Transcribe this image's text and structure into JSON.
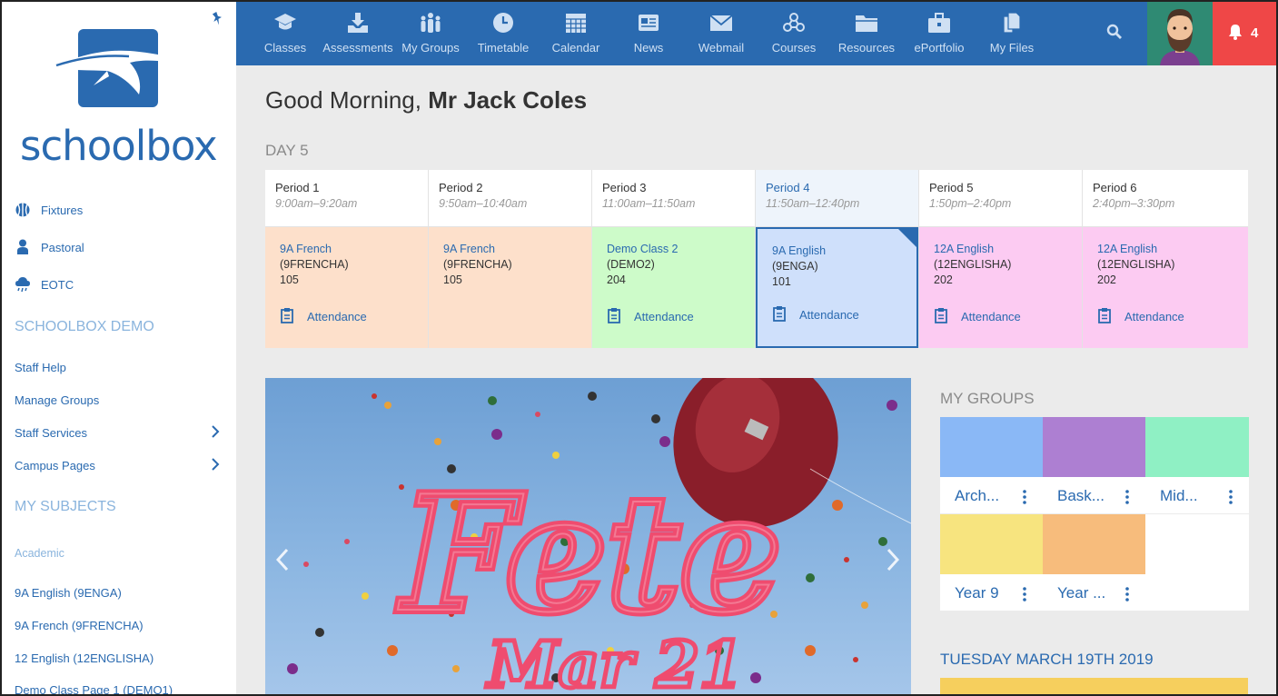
{
  "brand": {
    "name": "schoolbox",
    "color": "#2a6ab0"
  },
  "sidebar": {
    "quick_links": [
      {
        "label": "Fixtures",
        "icon": "basketball-icon"
      },
      {
        "label": "Pastoral",
        "icon": "person-icon"
      },
      {
        "label": "EOTC",
        "icon": "weather-icon"
      }
    ],
    "section1_title": "SCHOOLBOX DEMO",
    "section1_links": [
      "Staff Help",
      "Manage Groups",
      "Staff Services",
      "Campus Pages"
    ],
    "section2_title": "MY SUBJECTS",
    "section2_sub": "Academic",
    "subjects": [
      "9A English (9ENGA)",
      "9A French (9FRENCHA)",
      "12 English (12ENGLISHA)",
      "Demo Class Page 1 (DEMO1)"
    ]
  },
  "topnav": {
    "items": [
      {
        "label": "Classes",
        "icon": "graduation-cap-icon"
      },
      {
        "label": "Assessments",
        "icon": "download-tray-icon"
      },
      {
        "label": "My Groups",
        "icon": "people-icon"
      },
      {
        "label": "Timetable",
        "icon": "clock-icon"
      },
      {
        "label": "Calendar",
        "icon": "calendar-icon"
      },
      {
        "label": "News",
        "icon": "newspaper-icon"
      },
      {
        "label": "Webmail",
        "icon": "envelope-icon"
      },
      {
        "label": "Courses",
        "icon": "molecule-icon"
      },
      {
        "label": "Resources",
        "icon": "folder-icon"
      },
      {
        "label": "ePortfolio",
        "icon": "briefcase-icon"
      },
      {
        "label": "My Files",
        "icon": "files-icon"
      }
    ],
    "notification_count": "4"
  },
  "greeting": {
    "prefix": "Good Morning,",
    "name": "Mr Jack Coles"
  },
  "day_label": "DAY 5",
  "timetable": [
    {
      "period": "Period 1",
      "time": "9:00am–9:20am",
      "class": "9A French",
      "code": "(9FRENCHA)",
      "room": "105",
      "attendance": "Attendance",
      "color": "#fde0cb"
    },
    {
      "period": "Period 2",
      "time": "9:50am–10:40am",
      "class": "9A French",
      "code": "(9FRENCHA)",
      "room": "105",
      "attendance": "",
      "color": "#fde0cb"
    },
    {
      "period": "Period 3",
      "time": "11:00am–11:50am",
      "class": "Demo Class 2",
      "code": "(DEMO2)",
      "room": "204",
      "attendance": "Attendance",
      "color": "#cdfbc9"
    },
    {
      "period": "Period 4",
      "time": "11:50am–12:40pm",
      "class": "9A English",
      "code": "(9ENGA)",
      "room": "101",
      "attendance": "Attendance",
      "color": "#cfe0fb"
    },
    {
      "period": "Period 5",
      "time": "1:50pm–2:40pm",
      "class": "12A English",
      "code": "(12ENGLISHA)",
      "room": "202",
      "attendance": "Attendance",
      "color": "#fccbf2"
    },
    {
      "period": "Period 6",
      "time": "2:40pm–3:30pm",
      "class": "12A English",
      "code": "(12ENGLISHA)",
      "room": "202",
      "attendance": "Attendance",
      "color": "#fccbf2"
    }
  ],
  "banner": {
    "title": "Fete",
    "subtitle": "Mar 21"
  },
  "my_groups": {
    "title": "MY GROUPS",
    "groups": [
      {
        "label": "Arch...",
        "color": "#8ab8f6"
      },
      {
        "label": "Bask...",
        "color": "#ad7fd2"
      },
      {
        "label": "Mid...",
        "color": "#8ff0c4"
      },
      {
        "label": "Year 9",
        "color": "#f7e47f"
      },
      {
        "label": "Year ...",
        "color": "#f7bc7c"
      }
    ]
  },
  "calendar_heading": "TUESDAY MARCH 19TH 2019"
}
